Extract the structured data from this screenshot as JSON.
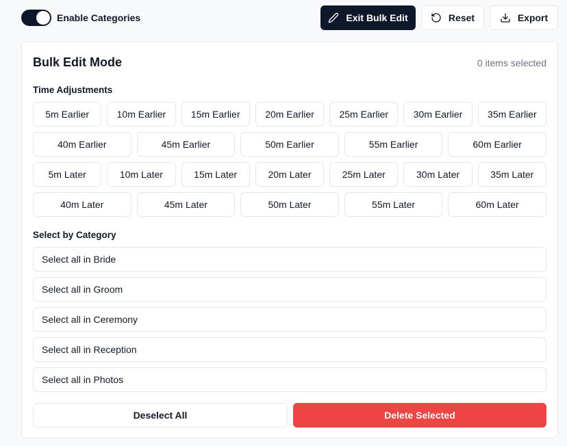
{
  "header": {
    "toggle_label": "Enable Categories",
    "toggle_on": true,
    "exit_label": "Exit Bulk Edit",
    "reset_label": "Reset",
    "export_label": "Export"
  },
  "panel": {
    "title": "Bulk Edit Mode",
    "selected_count": "0 items selected",
    "time_adjustments_label": "Time Adjustments",
    "earlier_row1": [
      "5m Earlier",
      "10m Earlier",
      "15m Earlier",
      "20m Earlier",
      "25m Earlier",
      "30m Earlier",
      "35m Earlier"
    ],
    "earlier_row2": [
      "40m Earlier",
      "45m Earlier",
      "50m Earlier",
      "55m Earlier",
      "60m Earlier"
    ],
    "later_row1": [
      "5m Later",
      "10m Later",
      "15m Later",
      "20m Later",
      "25m Later",
      "30m Later",
      "35m Later"
    ],
    "later_row2": [
      "40m Later",
      "45m Later",
      "50m Later",
      "55m Later",
      "60m Later"
    ],
    "category_label": "Select by Category",
    "categories": [
      "Select all in Bride",
      "Select all in Groom",
      "Select all in Ceremony",
      "Select all in Reception",
      "Select all in Photos"
    ],
    "deselect_label": "Deselect All",
    "delete_label": "Delete Selected"
  },
  "colors": {
    "primary_dark": "#0f172a",
    "danger": "#ef4444",
    "border": "#e5e7eb",
    "muted_text": "#6b7280"
  }
}
